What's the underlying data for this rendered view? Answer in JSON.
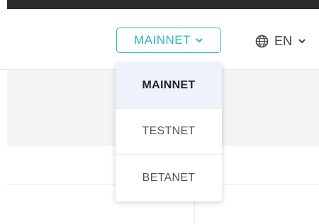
{
  "header": {
    "network_select": {
      "selected": "MAINNET",
      "icon": "chevron-down-icon"
    },
    "language_select": {
      "selected": "EN",
      "icon": "globe-icon",
      "chevron_icon": "chevron-down-icon"
    }
  },
  "network_dropdown": {
    "items": [
      {
        "label": "MAINNET",
        "selected": true
      },
      {
        "label": "TESTNET",
        "selected": false
      },
      {
        "label": "BETANET",
        "selected": false
      }
    ]
  },
  "colors": {
    "accent": "#2bb5c0",
    "selected_bg": "#eef2fb",
    "topbar": "#2b2b2b",
    "band": "#f4f4f4"
  }
}
